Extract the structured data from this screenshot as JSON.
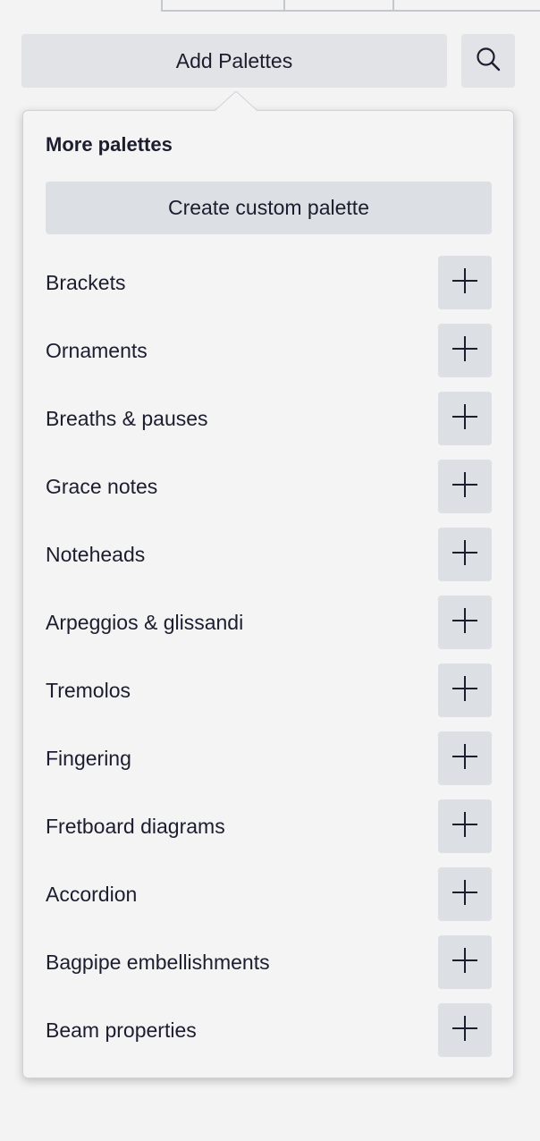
{
  "toolbar": {
    "add_palettes_label": "Add Palettes",
    "search_icon": "search-icon"
  },
  "popup": {
    "title": "More palettes",
    "create_custom_label": "Create custom palette",
    "add_icon": "plus-icon",
    "palettes": [
      {
        "label": "Brackets"
      },
      {
        "label": "Ornaments"
      },
      {
        "label": "Breaths & pauses"
      },
      {
        "label": "Grace notes"
      },
      {
        "label": "Noteheads"
      },
      {
        "label": "Arpeggios & glissandi"
      },
      {
        "label": "Tremolos"
      },
      {
        "label": "Fingering"
      },
      {
        "label": "Fretboard diagrams"
      },
      {
        "label": "Accordion"
      },
      {
        "label": "Bagpipe embellishments"
      },
      {
        "label": "Beam properties"
      }
    ]
  },
  "colors": {
    "background": "#f3f3f4",
    "panel": "#f4f4f5",
    "button": "#e1e3e6",
    "text": "#1c1d2e"
  }
}
